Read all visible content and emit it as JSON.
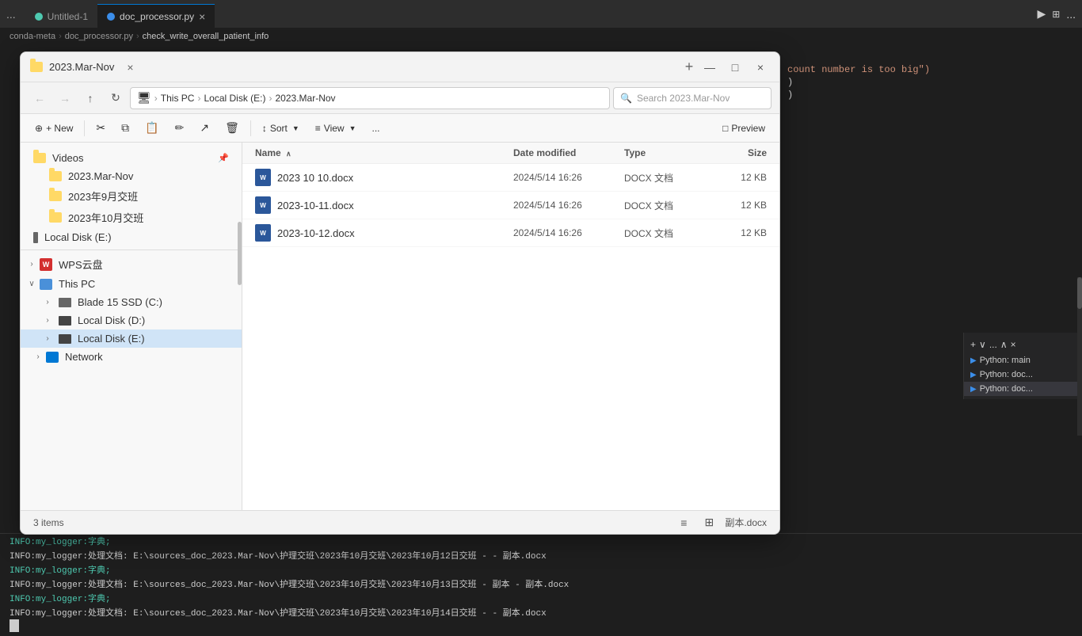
{
  "vscode": {
    "titlebar": {
      "dots_label": "...",
      "tab1_label": "Untitled-1",
      "tab2_label": "doc_processor.py",
      "tab2_close": "×",
      "run_icon": "▶",
      "layout_icon": "⊞",
      "more_icon": "..."
    },
    "breadcrumb": {
      "part1": "conda-meta",
      "sep1": "›",
      "part2": "doc_processor.py",
      "sep2": "›",
      "part3": "check_write_overall_patient_info"
    },
    "code_lines": [
      {
        "text": "count number is too big\")",
        "color": "#ce9178"
      },
      {
        "text": ")",
        "color": "#d4d4d4"
      },
      {
        "text": ")",
        "color": "#d4d4d4"
      }
    ],
    "right_panel": {
      "items": [
        {
          "label": "Python: main",
          "active": false
        },
        {
          "label": "Python: doc...",
          "active": false
        },
        {
          "label": "Python: doc...",
          "active": true
        }
      ]
    },
    "terminal": {
      "lines": [
        "INFO:my_logger:字典;",
        "INFO:my_logger:处理文档: E:\\sources_doc_2023.Mar-Nov\\护理交班\\2023年10月交班\\2023年10月12日交班    -  - 副本.docx",
        "INFO:my_logger:字典;",
        "INFO:my_logger:处理文档: E:\\sources_doc_2023.Mar-Nov\\护理交班\\2023年10月交班\\2023年10月13日交班    - 副本 - 副本.docx",
        "INFO:my_logger:字典;",
        "INFO:my_logger:处理文档: E:\\sources_doc_2023.Mar-Nov\\护理交班\\2023年10月交班\\2023年10月14日交班    -  - 副本.docx"
      ]
    }
  },
  "explorer": {
    "window": {
      "title": "2023.Mar-Nov",
      "close_btn": "×",
      "minimize_btn": "—",
      "maximize_btn": "□",
      "new_tab_btn": "+"
    },
    "navbar": {
      "back_btn": "←",
      "forward_btn": "→",
      "up_btn": "↑",
      "refresh_btn": "↻",
      "this_pc": "This PC",
      "local_disk": "Local Disk (E:)",
      "current_folder": "2023.Mar-Nov",
      "search_placeholder": "Search 2023.Mar-Nov",
      "search_icon": "🔍",
      "pc_icon": "🖥"
    },
    "toolbar": {
      "new_btn": "+ New",
      "cut_icon": "✂",
      "copy_icon": "⧉",
      "paste_icon": "📋",
      "rename_icon": "✏",
      "share_icon": "↗",
      "delete_icon": "🗑",
      "sort_btn": "↕ Sort",
      "sort_arrow": "▼",
      "view_btn": "≡ View",
      "view_arrow": "▼",
      "more_btn": "...",
      "preview_btn": "□ Preview"
    },
    "sidebar": {
      "items": [
        {
          "label": "Videos",
          "type": "folder",
          "pinned": true,
          "has_pin": true
        },
        {
          "label": "2023.Mar-Nov",
          "type": "folder_yellow"
        },
        {
          "label": "2023年9月交班",
          "type": "folder_yellow"
        },
        {
          "label": "2023年10月交班",
          "type": "folder_yellow"
        },
        {
          "label": "Local Disk (E:)",
          "type": "drive"
        },
        {
          "label": "WPS云盘",
          "type": "wps",
          "expandable": true
        },
        {
          "label": "This PC",
          "type": "pc",
          "expanded": true,
          "expandable": true
        },
        {
          "label": "Blade 15 SSD (C:)",
          "type": "drive_sub",
          "expandable": true
        },
        {
          "label": "Local Disk (D:)",
          "type": "drive_sub",
          "expandable": true
        },
        {
          "label": "Local Disk (E:)",
          "type": "drive_sub_selected",
          "expandable": true
        },
        {
          "label": "Network",
          "type": "network",
          "expandable": true
        }
      ]
    },
    "filelist": {
      "headers": {
        "name": "Name",
        "date": "Date modified",
        "type": "Type",
        "size": "Size",
        "sort_arrow": "∧"
      },
      "files": [
        {
          "name": "2023 10 10.docx",
          "date": "2024/5/14 16:26",
          "type": "DOCX 文档",
          "size": "12 KB"
        },
        {
          "name": "2023-10-11.docx",
          "date": "2024/5/14 16:26",
          "type": "DOCX 文档",
          "size": "12 KB"
        },
        {
          "name": "2023-10-12.docx",
          "date": "2024/5/14 16:26",
          "type": "DOCX 文档",
          "size": "12 KB"
        }
      ]
    },
    "statusbar": {
      "item_count": "3 items",
      "file_label": "副本.docx"
    }
  }
}
